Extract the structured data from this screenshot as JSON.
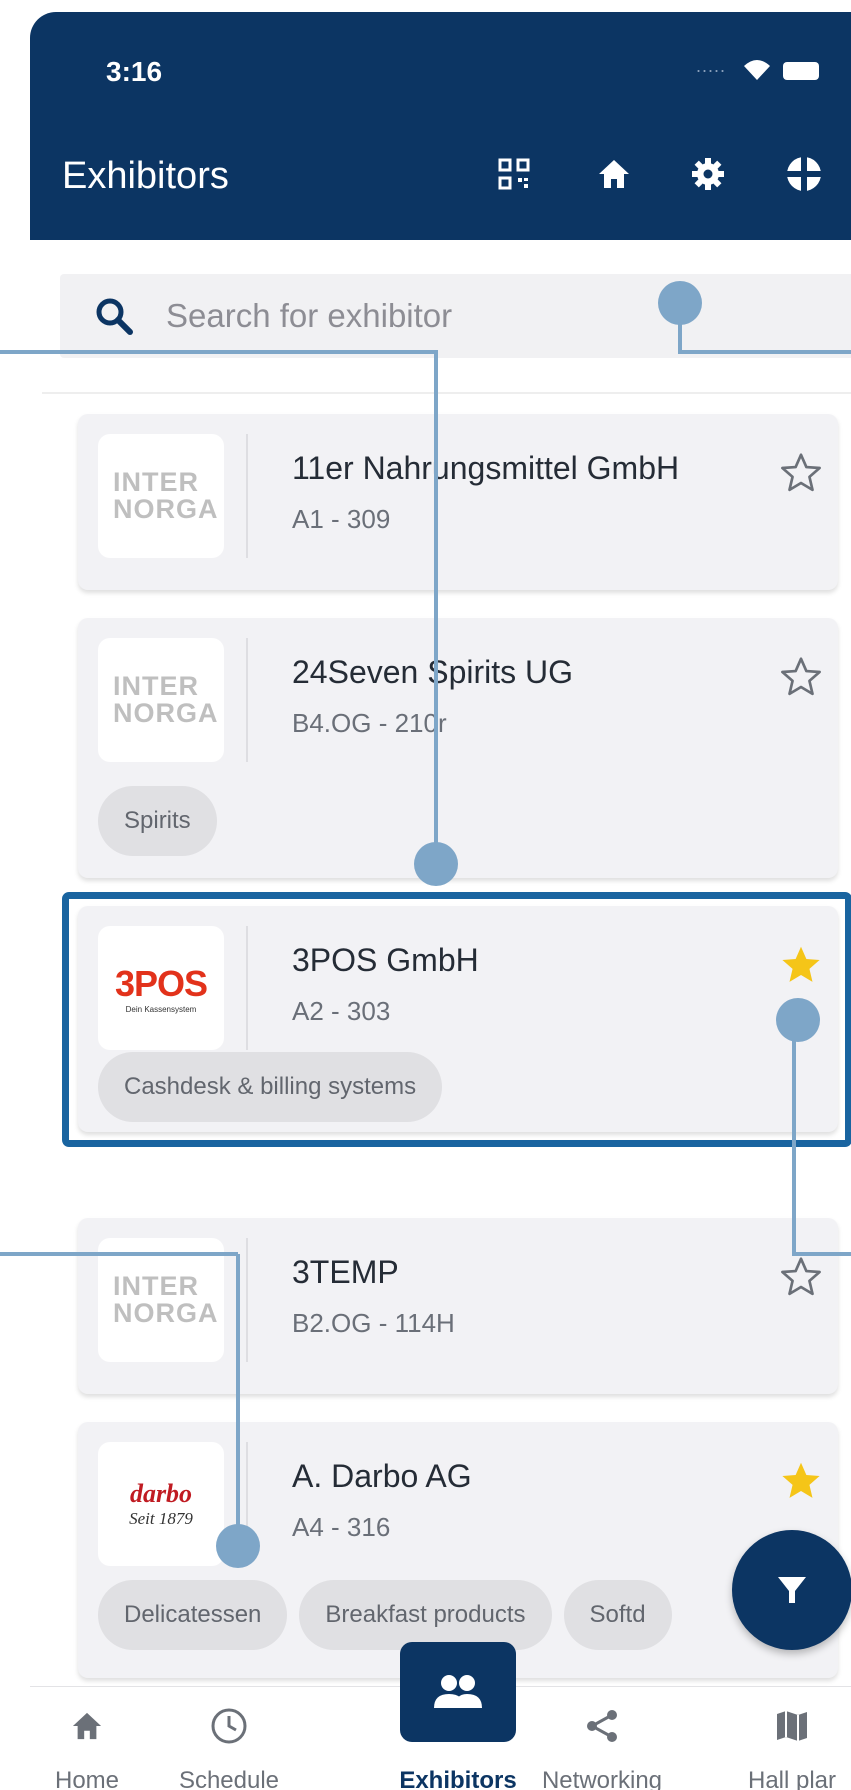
{
  "status": {
    "time": "3:16",
    "signal_dots": "....."
  },
  "header": {
    "title": "Exhibitors"
  },
  "search": {
    "placeholder": "Search for exhibitor"
  },
  "exhibitors": [
    {
      "name": "11er Nahrungsmittel GmbH",
      "booth": "A1 - 309",
      "logo": "INTER NORGA",
      "favorite": false,
      "tags": []
    },
    {
      "name": "24Seven Spirits UG",
      "booth": "B4.OG - 210r",
      "logo": "INTER NORGA",
      "favorite": false,
      "tags": [
        "Spirits"
      ]
    },
    {
      "name": "3POS GmbH",
      "booth": "A2 - 303",
      "logo": "3POS",
      "logo_sub": "Dein Kassensystem",
      "favorite": true,
      "tags": [
        "Cashdesk & billing systems"
      ]
    },
    {
      "name": "3TEMP",
      "booth": "B2.OG - 114H",
      "logo": "INTER NORGA",
      "favorite": false,
      "tags": []
    },
    {
      "name": "A. Darbo AG",
      "booth": "A4 - 316",
      "logo": "darbo",
      "logo_sub": "Seit 1879",
      "favorite": true,
      "tags": [
        "Delicatessen",
        "Breakfast products",
        "Softd"
      ]
    }
  ],
  "nav": {
    "home": "Home",
    "schedule": "Schedule",
    "exhibitors": "Exhibitors",
    "networking": "Networking",
    "hallplan": "Hall plar"
  },
  "colors": {
    "primary": "#0c3563",
    "accent_star": "#f5c518",
    "highlight": "#1964a0",
    "callout": "#7ea6c8"
  }
}
